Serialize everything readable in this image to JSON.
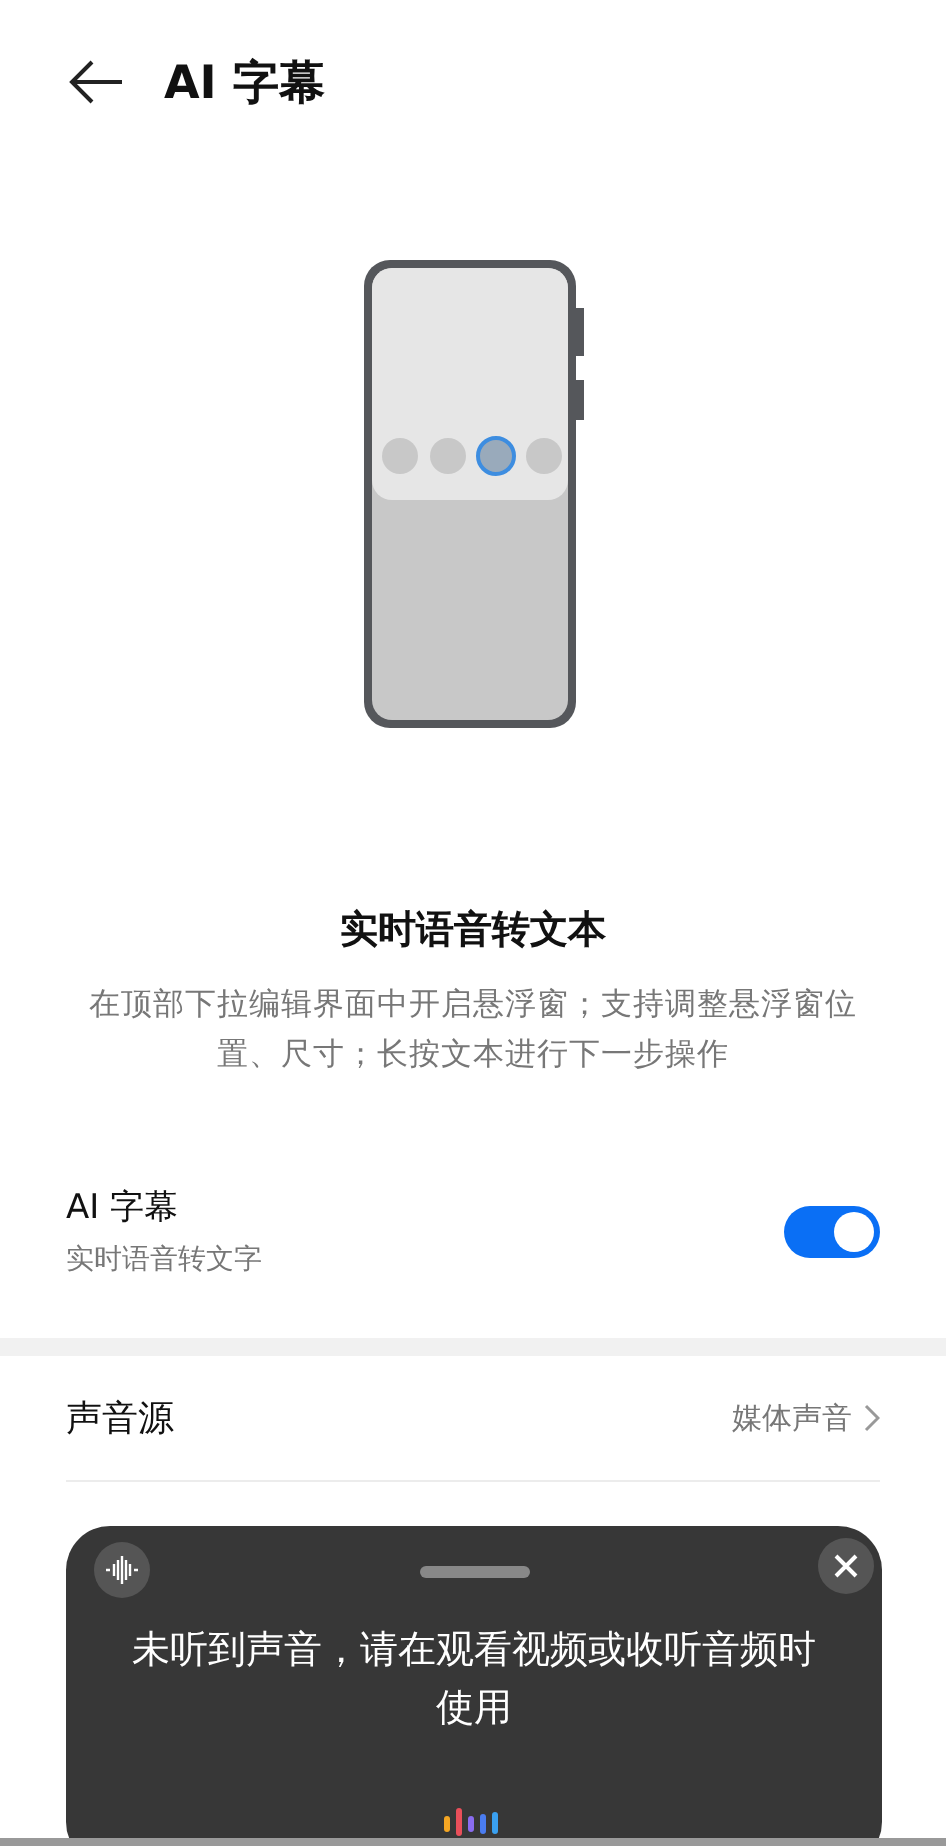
{
  "header": {
    "title": "AI 字幕"
  },
  "feature": {
    "title": "实时语音转文本",
    "description": "在顶部下拉编辑界面中开启悬浮窗；支持调整悬浮窗位置、尺寸；长按文本进行下一步操作"
  },
  "toggle_row": {
    "title": "AI 字幕",
    "subtitle": "实时语音转文字",
    "on": true
  },
  "settings": [
    {
      "label": "声音源",
      "value": "媒体声音"
    }
  ],
  "floating_window": {
    "message": "未听到声音，请在观看视频或收听音频时使用"
  }
}
